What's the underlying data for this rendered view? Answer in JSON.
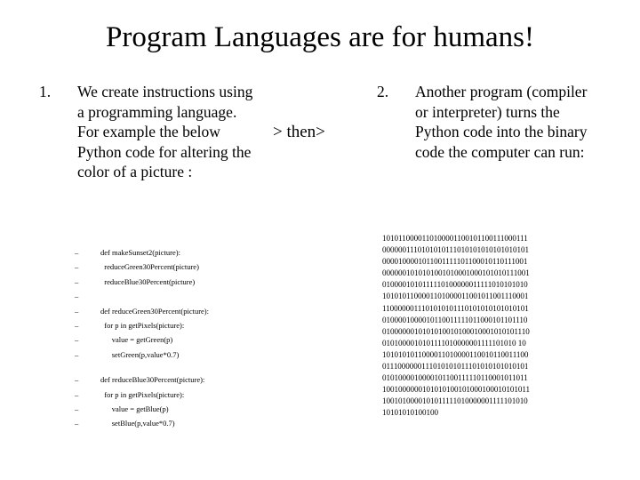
{
  "slide": {
    "title": "Program Languages are for humans!",
    "transition_label": "> then>",
    "points": [
      {
        "number": "1.",
        "text": "We create instructions using a programming language.  For example the below Python code for altering the color of a picture :"
      },
      {
        "number": "2.",
        "text": "Another program (compiler or interpreter) turns the Python code into the binary code the computer can run:"
      }
    ],
    "code": {
      "bullet": "–",
      "lines": [
        "def makeSunset2(picture):",
        "  reduceGreen30Percent(picture)",
        "  reduceBlue30Percent(picture)",
        "",
        "def reduceGreen30Percent(picture):",
        "  for p in getPixels(picture):",
        "      value = getGreen(p)",
        "      setGreen(p,value*0.7)",
        "def reduceBlue30Percent(picture):",
        "  for p in getPixels(picture):",
        "      value = getBlue(p)",
        "      setBlue(p,value*0.7)"
      ]
    },
    "binary": {
      "lines": [
        "1010110000110100001100101100111000111",
        "0000001110101010111010101010101010101",
        "0000100001011001111101100010110111001",
        "0000001010101001010001000101010111001",
        "0100001010111110100000011111010101010",
        "1010101100001101000011001011001110001",
        "1100000011101010101110101010101010101",
        "0100001000010110011111011000101101110",
        "0100000010101010010100010001010101110",
        "0101000010101111010000001111101010 10",
        "1010101011000011010000110010110011100",
        "0111000000111010101011101010101010101",
        "0101000010000101100111110110001011011",
        "1001000000101010100101000100010101011",
        "1001010000101011111010000001111101010",
        "10101010100100"
      ]
    }
  }
}
